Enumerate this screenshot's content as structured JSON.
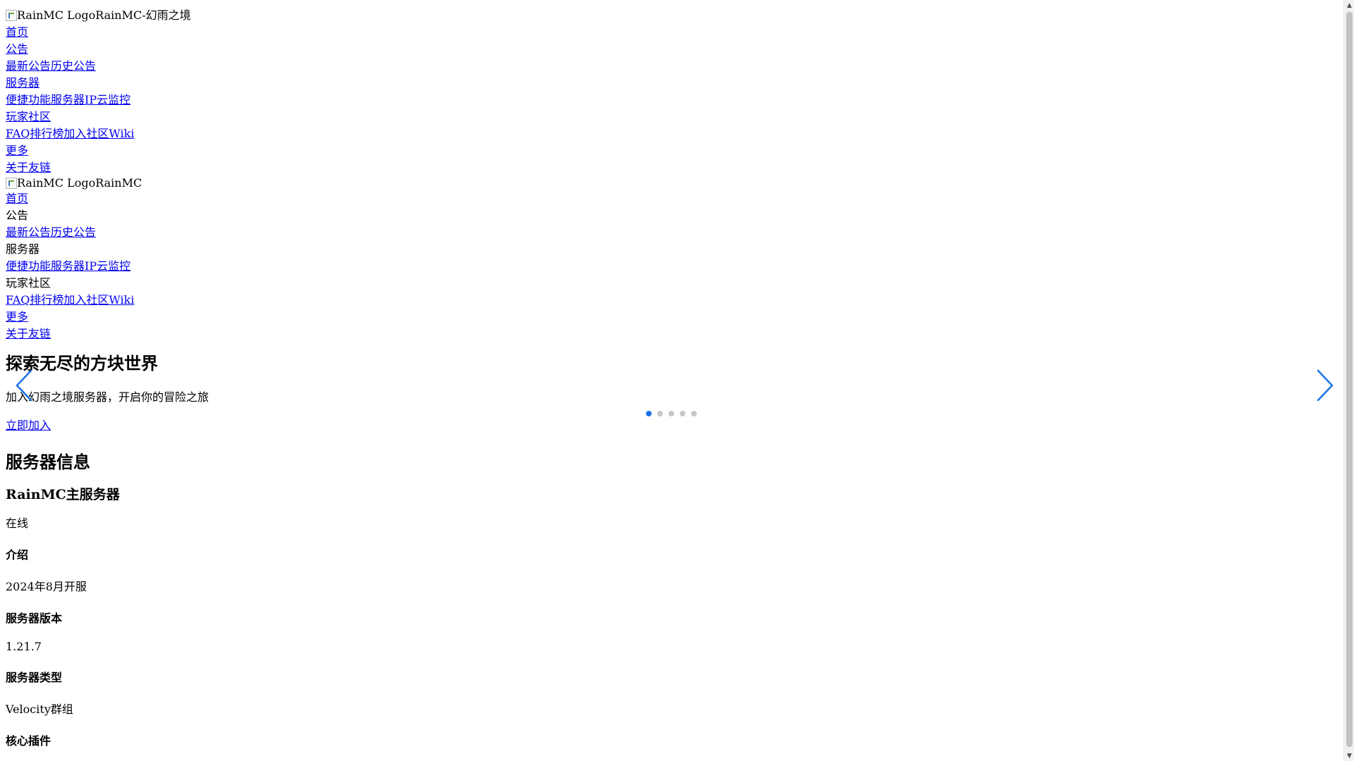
{
  "nav_main": {
    "logo_alt": "RainMC Logo",
    "site_title": "RainMC-幻雨之境",
    "home": "首页",
    "announcements": "公告",
    "announcement_links": "最新公告历史公告",
    "server": "服务器",
    "server_links": "便捷功能服务器IP云监控",
    "community": "玩家社区",
    "community_links": "FAQ排行榜加入社区Wiki",
    "more": "更多",
    "more_links": "关于友链"
  },
  "nav_mobile": {
    "logo_alt": "RainMC Logo",
    "site_title": "RainMC",
    "home": "首页",
    "announcements": "公告",
    "announcement_links": "最新公告历史公告",
    "server": "服务器",
    "server_links": "便捷功能服务器IP云监控",
    "community": "玩家社区",
    "community_links": "FAQ排行榜加入社区Wiki",
    "more": "更多",
    "more_links": "关于友链"
  },
  "hero": {
    "title": "探索无尽的方块世界",
    "subtitle": "加入幻雨之境服务器，开启你的冒险之旅",
    "cta": "立即加入",
    "slide_count": 5,
    "active_slide": 1
  },
  "server_info": {
    "section_title": "服务器信息",
    "server_name": "RainMC主服务器",
    "status": "在线",
    "intro_label": "介绍",
    "intro_value": "2024年8月开服",
    "version_label": "服务器版本",
    "version_value": "1.21.7",
    "type_label": "服务器类型",
    "type_value": "Velocity群组",
    "plugins_label": "核心插件"
  },
  "colors": {
    "link": "#0000ee",
    "dot_active": "#1a73e8",
    "dot_inactive": "#c7c7c7",
    "arrow": "#1a73e8"
  },
  "icons": {
    "prev": "chevron-left-icon",
    "next": "chevron-right-icon",
    "logo": "broken-image-icon"
  }
}
